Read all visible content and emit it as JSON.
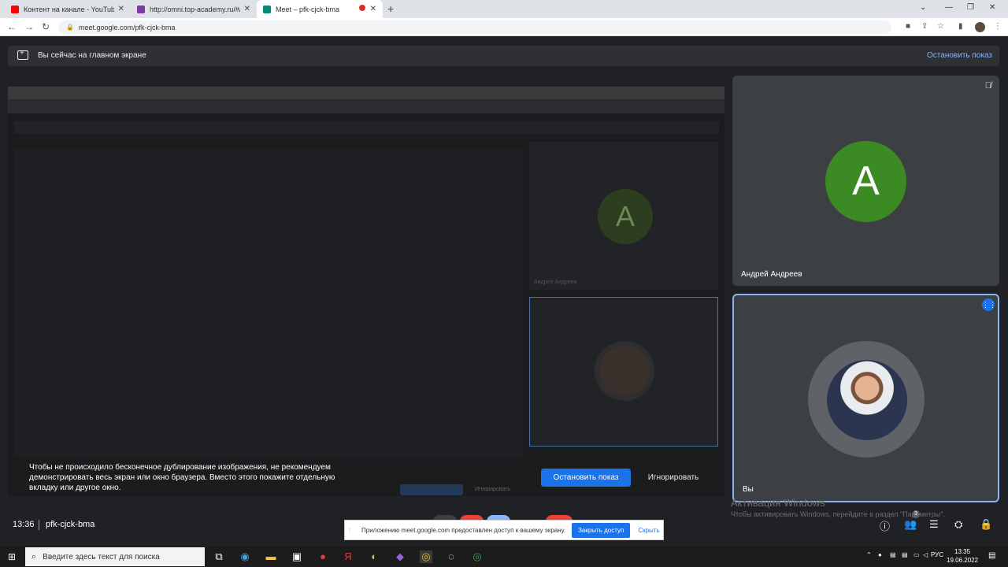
{
  "browser": {
    "tabs": [
      {
        "label": "Контент на канале - YouTube St",
        "color": "#ff0000"
      },
      {
        "label": "http://omni.top-academy.ru/#/",
        "color": "#7a3ba8"
      },
      {
        "label": "Meet – pfk-cjck-bma",
        "color": "#00897b",
        "active": true
      }
    ],
    "url": "meet.google.com/pfk-cjck-bma"
  },
  "meet": {
    "banner_text": "Вы сейчас на главном экране",
    "stop_share_link": "Остановить показ",
    "notice": "Чтобы не происходило бесконечное дублирование изображения, не рекомендуем демонстрировать весь экран или окно браузера. Вместо этого покажите отдельную вкладку или другое окно.",
    "stop_button": "Остановить показ",
    "ignore_button": "Игнорировать",
    "participants": [
      {
        "name": "Андрей Андреев",
        "initial": "A",
        "color": "#3c8a23",
        "muted": true
      },
      {
        "name": "Вы",
        "speaking": true
      }
    ],
    "meeting_time": "13:36",
    "meeting_code": "pfk-cjck-bma",
    "participants_count": "3",
    "mini": {
      "initial": "A",
      "name": "Андрей Андреев",
      "stop": "Остановить показ",
      "ignore": "Игнорировать"
    }
  },
  "access_bar": {
    "text": "Приложению meet.google.com предоставлен доступ к вашему экрану.",
    "close_label": "Закрыть доступ",
    "hide_label": "Скрыть"
  },
  "windows": {
    "activation_title": "Активация Windows",
    "activation_sub": "Чтобы активировать Windows, перейдите в раздел \"Параметры\".",
    "search_placeholder": "Введите здесь текст для поиска",
    "lang": "РУС",
    "time": "13:35",
    "date": "19.06.2022"
  }
}
